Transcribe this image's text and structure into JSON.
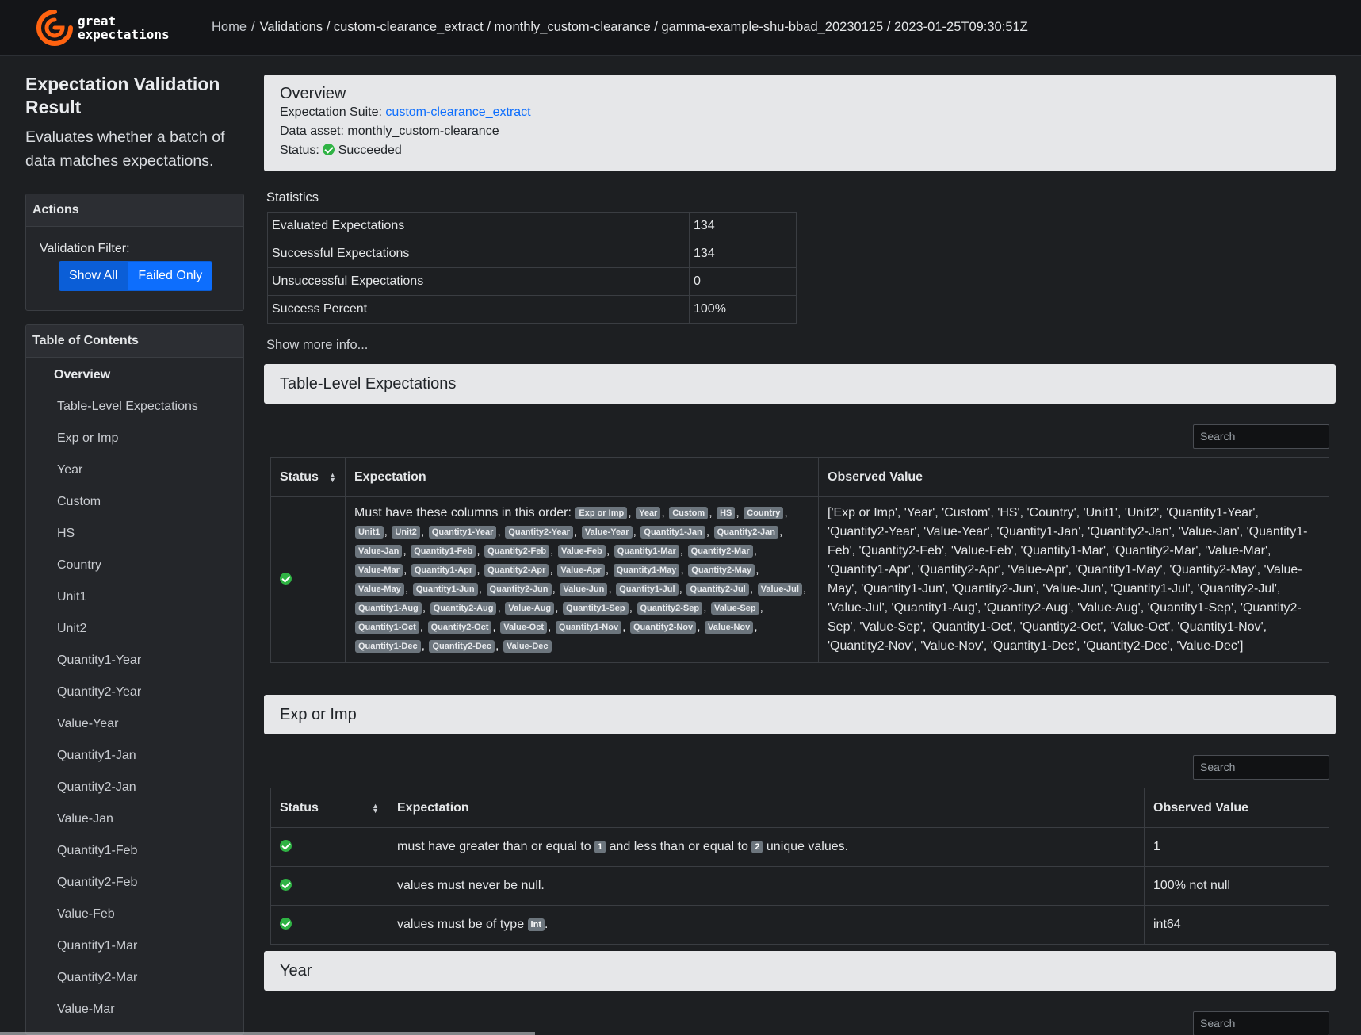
{
  "app": {
    "logo_line1": "great",
    "logo_line2": "expectations"
  },
  "breadcrumb": {
    "home": "Home",
    "path": "Validations / custom-clearance_extract / monthly_custom-clearance / gamma-example-shu-bbad_20230125 / 2023-01-25T09:30:51Z"
  },
  "sidebar": {
    "title": "Expectation Validation Result",
    "description": "Evaluates whether a batch of data matches expectations.",
    "actions_header": "Actions",
    "filter_label": "Validation Filter:",
    "show_all": "Show All",
    "failed_only": "Failed Only",
    "toc_header": "Table of Contents",
    "toc": [
      "Overview",
      "Table-Level Expectations",
      "Exp or Imp",
      "Year",
      "Custom",
      "HS",
      "Country",
      "Unit1",
      "Unit2",
      "Quantity1-Year",
      "Quantity2-Year",
      "Value-Year",
      "Quantity1-Jan",
      "Quantity2-Jan",
      "Value-Jan",
      "Quantity1-Feb",
      "Quantity2-Feb",
      "Value-Feb",
      "Quantity1-Mar",
      "Quantity2-Mar",
      "Value-Mar"
    ]
  },
  "overview": {
    "title": "Overview",
    "suite_label": "Expectation Suite:",
    "suite_value": "custom-clearance_extract",
    "asset_label": "Data asset:",
    "asset_value": "monthly_custom-clearance",
    "status_label": "Status:",
    "status_value": "Succeeded"
  },
  "statistics": {
    "title": "Statistics",
    "rows": [
      {
        "label": "Evaluated Expectations",
        "value": "134"
      },
      {
        "label": "Successful Expectations",
        "value": "134"
      },
      {
        "label": "Unsuccessful Expectations",
        "value": "0"
      },
      {
        "label": "Success Percent",
        "value": "100%"
      }
    ],
    "show_more": "Show more info..."
  },
  "search_placeholder": "Search",
  "table_level": {
    "title": "Table-Level Expectations",
    "headers": [
      "Status",
      "Expectation",
      "Observed Value"
    ],
    "expectation_prefix": "Must have these columns in this order:",
    "columns": [
      "Exp or Imp",
      "Year",
      "Custom",
      "HS",
      "Country",
      "Unit1",
      "Unit2",
      "Quantity1-Year",
      "Quantity2-Year",
      "Value-Year",
      "Quantity1-Jan",
      "Quantity2-Jan",
      "Value-Jan",
      "Quantity1-Feb",
      "Quantity2-Feb",
      "Value-Feb",
      "Quantity1-Mar",
      "Quantity2-Mar",
      "Value-Mar",
      "Quantity1-Apr",
      "Quantity2-Apr",
      "Value-Apr",
      "Quantity1-May",
      "Quantity2-May",
      "Value-May",
      "Quantity1-Jun",
      "Quantity2-Jun",
      "Value-Jun",
      "Quantity1-Jul",
      "Quantity2-Jul",
      "Value-Jul",
      "Quantity1-Aug",
      "Quantity2-Aug",
      "Value-Aug",
      "Quantity1-Sep",
      "Quantity2-Sep",
      "Value-Sep",
      "Quantity1-Oct",
      "Quantity2-Oct",
      "Value-Oct",
      "Quantity1-Nov",
      "Quantity2-Nov",
      "Value-Nov",
      "Quantity1-Dec",
      "Quantity2-Dec",
      "Value-Dec"
    ],
    "observed": "['Exp or Imp', 'Year', 'Custom', 'HS', 'Country', 'Unit1', 'Unit2', 'Quantity1-Year', 'Quantity2-Year', 'Value-Year', 'Quantity1-Jan', 'Quantity2-Jan', 'Value-Jan', 'Quantity1-Feb', 'Quantity2-Feb', 'Value-Feb', 'Quantity1-Mar', 'Quantity2-Mar', 'Value-Mar', 'Quantity1-Apr', 'Quantity2-Apr', 'Value-Apr', 'Quantity1-May', 'Quantity2-May', 'Value-May', 'Quantity1-Jun', 'Quantity2-Jun', 'Value-Jun', 'Quantity1-Jul', 'Quantity2-Jul', 'Value-Jul', 'Quantity1-Aug', 'Quantity2-Aug', 'Value-Aug', 'Quantity1-Sep', 'Quantity2-Sep', 'Value-Sep', 'Quantity1-Oct', 'Quantity2-Oct', 'Value-Oct', 'Quantity1-Nov', 'Quantity2-Nov', 'Value-Nov', 'Quantity1-Dec', 'Quantity2-Dec', 'Value-Dec']"
  },
  "exp_or_imp": {
    "title": "Exp or Imp",
    "headers": [
      "Status",
      "Expectation",
      "Observed Value"
    ],
    "rows": [
      {
        "pre": "must have greater than or equal to",
        "p1": "1",
        "mid": "and less than or equal to",
        "p2": "2",
        "post": "unique values.",
        "observed": "1"
      },
      {
        "text": "values must never be null.",
        "observed": "100% not null"
      },
      {
        "pre": "values must be of type",
        "p1": "int",
        "post": ".",
        "observed": "int64"
      }
    ]
  },
  "year": {
    "title": "Year"
  },
  "colors": {
    "success": "#2fb344",
    "accent": "#0d6efd",
    "pill": "#6c757d"
  }
}
